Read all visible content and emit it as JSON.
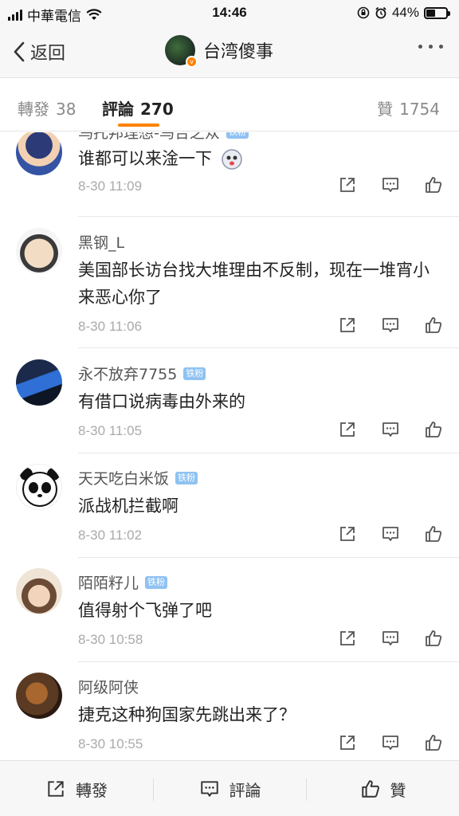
{
  "status_bar": {
    "carrier": "中華電信",
    "time": "14:46",
    "battery": "44%",
    "battery_level": 0.44
  },
  "nav": {
    "back_label": "返回",
    "title": "台湾傻事"
  },
  "tabs": {
    "repost_label": "轉發",
    "repost_count": "38",
    "comment_label": "評論",
    "comment_count": "270",
    "like_label": "贊",
    "like_count": "1754"
  },
  "comments": [
    {
      "name": "乌托邦理想-乌合之众",
      "badge": "铁粉",
      "text": "谁都可以来淦一下",
      "time": "8-30 11:09"
    },
    {
      "name": "黑钢_L",
      "badge": "",
      "text": "美国部长访台找大堆理由不反制，现在一堆宵小来恶心你了",
      "time": "8-30 11:06"
    },
    {
      "name": "永不放弃7755",
      "badge": "铁粉",
      "text": "有借口说病毒由外来的",
      "time": "8-30 11:05"
    },
    {
      "name": "天天吃白米饭",
      "badge": "铁粉",
      "text": "派战机拦截啊",
      "time": "8-30 11:02"
    },
    {
      "name": "陌陌籽儿",
      "badge": "铁粉",
      "text": "值得射个飞弹了吧",
      "time": "8-30 10:58"
    },
    {
      "name": "阿级阿侠",
      "badge": "",
      "text": "捷克这种狗国家先跳出来了？",
      "time": "8-30 10:55"
    }
  ],
  "bottom_bar": {
    "repost": "轉發",
    "comment": "評論",
    "like": "贊"
  },
  "icons": {
    "repost": "share-icon",
    "comment": "comment-icon",
    "like": "thumbs-up-icon"
  },
  "colors": {
    "accent": "#ff8200",
    "badge": "#8fc2f2"
  }
}
